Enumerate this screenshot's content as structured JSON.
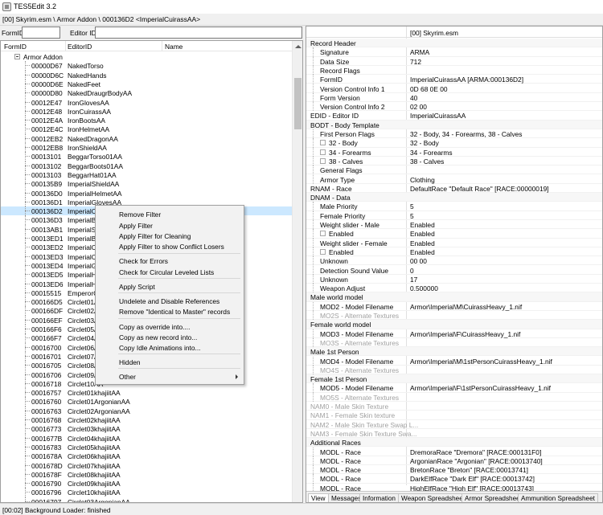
{
  "window": {
    "title": "TES5Edit 3.2",
    "icon": "app-icon"
  },
  "path": "[00] Skyrim.esm \\ Armor Addon \\ 000136D2 <ImperialCuirassAA>",
  "filter": {
    "formid_label": "FormID",
    "editorid_label": "Editor ID",
    "formid_value": "",
    "editorid_value": ""
  },
  "tree": {
    "columns": [
      "FormID",
      "EditorID",
      "Name"
    ],
    "root": "Armor Addon",
    "rows": [
      {
        "formid": "00000D67",
        "editorid": "NakedTorso"
      },
      {
        "formid": "00000D6C",
        "editorid": "NakedHands"
      },
      {
        "formid": "00000D6E",
        "editorid": "NakedFeet"
      },
      {
        "formid": "00000D80",
        "editorid": "NakedDraugrBodyAA"
      },
      {
        "formid": "00012E47",
        "editorid": "IronGlovesAA"
      },
      {
        "formid": "00012E48",
        "editorid": "IronCuirassAA"
      },
      {
        "formid": "00012E4A",
        "editorid": "IronBootsAA"
      },
      {
        "formid": "00012E4C",
        "editorid": "IronHelmetAA"
      },
      {
        "formid": "00012EB2",
        "editorid": "NakedDragonAA"
      },
      {
        "formid": "00012EB8",
        "editorid": "IronShieldAA"
      },
      {
        "formid": "00013101",
        "editorid": "BeggarTorso01AA"
      },
      {
        "formid": "00013102",
        "editorid": "BeggarBoots01AA"
      },
      {
        "formid": "00013103",
        "editorid": "BeggarHat01AA"
      },
      {
        "formid": "000135B9",
        "editorid": "ImperialShieldAA"
      },
      {
        "formid": "000136D0",
        "editorid": "ImperialHelmetAA"
      },
      {
        "formid": "000136D1",
        "editorid": "ImperialGlovesAA"
      },
      {
        "formid": "000136D2",
        "editorid": "ImperialCuirassAA"
      },
      {
        "formid": "000136D3",
        "editorid": "ImperialBoot"
      },
      {
        "formid": "00013AB1",
        "editorid": "ImperialShiel"
      },
      {
        "formid": "00013ED1",
        "editorid": "ImperialBoot"
      },
      {
        "formid": "00013ED2",
        "editorid": "ImperialCuir"
      },
      {
        "formid": "00013ED3",
        "editorid": "ImperialCuir"
      },
      {
        "formid": "00013ED4",
        "editorid": "ImperialGlov"
      },
      {
        "formid": "00013ED5",
        "editorid": "ImperialHelm"
      },
      {
        "formid": "00013ED6",
        "editorid": "ImperialHelm"
      },
      {
        "formid": "00015515",
        "editorid": "EmperorClot"
      },
      {
        "formid": "000166D5",
        "editorid": "Circlet01AA"
      },
      {
        "formid": "000166DF",
        "editorid": "Circlet02AA"
      },
      {
        "formid": "000166EF",
        "editorid": "Circlet03AA"
      },
      {
        "formid": "000166F6",
        "editorid": "Circlet05AA"
      },
      {
        "formid": "000166F7",
        "editorid": "Circlet04AA"
      },
      {
        "formid": "00016700",
        "editorid": "Circlet06AA"
      },
      {
        "formid": "00016701",
        "editorid": "Circlet07AA"
      },
      {
        "formid": "00016705",
        "editorid": "Circlet08AA"
      },
      {
        "formid": "00016706",
        "editorid": "Circlet09AA"
      },
      {
        "formid": "00016718",
        "editorid": "Circlet10AA"
      },
      {
        "formid": "00016757",
        "editorid": "Circlet01khajiitAA"
      },
      {
        "formid": "00016760",
        "editorid": "Circlet01ArgonianAA"
      },
      {
        "formid": "00016763",
        "editorid": "Circlet02ArgonianAA"
      },
      {
        "formid": "00016768",
        "editorid": "Circlet02khajiitAA"
      },
      {
        "formid": "00016773",
        "editorid": "Circlet03khajiitAA"
      },
      {
        "formid": "0001677B",
        "editorid": "Circlet04khajiitAA"
      },
      {
        "formid": "00016783",
        "editorid": "Circlet05khajiitAA"
      },
      {
        "formid": "0001678A",
        "editorid": "Circlet06khajiitAA"
      },
      {
        "formid": "0001678D",
        "editorid": "Circlet07khajiitAA"
      },
      {
        "formid": "0001678F",
        "editorid": "Circlet08khajiitAA"
      },
      {
        "formid": "00016790",
        "editorid": "Circlet09khajiitAA"
      },
      {
        "formid": "00016796",
        "editorid": "Circlet10khajiitAA"
      },
      {
        "formid": "00016797",
        "editorid": "Circlet03ArgonianAA"
      },
      {
        "formid": "0001679D",
        "editorid": "Circlet04ArgonianAA"
      }
    ],
    "selected_index": 16
  },
  "context_menu": {
    "items": [
      "Remove Filter",
      "Apply Filter",
      "Apply Filter for Cleaning",
      "Apply Filter to show Conflict Losers",
      "Check for Errors",
      "Check for Circular Leveled Lists",
      "Apply Script",
      "Undelete and Disable References",
      "Remove \"Identical to Master\" records",
      "Copy as override into....",
      "Copy as new record into...",
      "Copy Idle Animations into...",
      "Hidden",
      "Other"
    ]
  },
  "record": {
    "file_header": "[00] Skyrim.esm",
    "rows": [
      {
        "name": "Record Header",
        "value": "",
        "indent": 0,
        "kind": "section"
      },
      {
        "name": "Signature",
        "value": "ARMA",
        "indent": 1
      },
      {
        "name": "Data Size",
        "value": "712",
        "indent": 1
      },
      {
        "name": "Record Flags",
        "value": "",
        "indent": 1
      },
      {
        "name": "FormID",
        "value": "ImperialCuirassAA [ARMA:000136D2]",
        "indent": 1
      },
      {
        "name": "Version Control Info 1",
        "value": "0D 68 0E 00",
        "indent": 1
      },
      {
        "name": "Form Version",
        "value": "40",
        "indent": 1
      },
      {
        "name": "Version Control Info 2",
        "value": "02 00",
        "indent": 1
      },
      {
        "name": "EDID - Editor ID",
        "value": "ImperialCuirassAA",
        "indent": 0
      },
      {
        "name": "BODT - Body Template",
        "value": "",
        "indent": 0,
        "kind": "section"
      },
      {
        "name": "First Person Flags",
        "value": "32 - Body, 34 - Forearms, 38 - Calves",
        "indent": 1
      },
      {
        "name": "32 - Body",
        "value": "32 - Body",
        "indent": 2
      },
      {
        "name": "34 - Forearms",
        "value": "34 - Forearms",
        "indent": 2
      },
      {
        "name": "38 - Calves",
        "value": "38 - Calves",
        "indent": 2
      },
      {
        "name": "General Flags",
        "value": "",
        "indent": 1
      },
      {
        "name": "Armor Type",
        "value": "Clothing",
        "indent": 1
      },
      {
        "name": "RNAM - Race",
        "value": "DefaultRace \"Default Race\" [RACE:00000019]",
        "indent": 0
      },
      {
        "name": "DNAM - Data",
        "value": "",
        "indent": 0,
        "kind": "section"
      },
      {
        "name": "Male Priority",
        "value": "5",
        "indent": 1
      },
      {
        "name": "Female Priority",
        "value": "5",
        "indent": 1
      },
      {
        "name": "Weight slider - Male",
        "value": "Enabled",
        "indent": 1
      },
      {
        "name": "Enabled",
        "value": "Enabled",
        "indent": 2
      },
      {
        "name": "Weight slider - Female",
        "value": "Enabled",
        "indent": 1
      },
      {
        "name": "Enabled",
        "value": "Enabled",
        "indent": 2
      },
      {
        "name": "Unknown",
        "value": "00 00",
        "indent": 1
      },
      {
        "name": "Detection Sound Value",
        "value": "0",
        "indent": 1
      },
      {
        "name": "Unknown",
        "value": "17",
        "indent": 1
      },
      {
        "name": "Weapon Adjust",
        "value": "0.500000",
        "indent": 1
      },
      {
        "name": "Male world model",
        "value": "",
        "indent": 0,
        "kind": "section"
      },
      {
        "name": "MOD2 - Model Filename",
        "value": "Armor\\Imperial\\M\\CuirassHeavy_1.nif",
        "indent": 1
      },
      {
        "name": "MO2S - Alternate Textures",
        "value": "",
        "indent": 1,
        "dim": true
      },
      {
        "name": "Female world model",
        "value": "",
        "indent": 0,
        "kind": "section"
      },
      {
        "name": "MOD3 - Model Filename",
        "value": "Armor\\Imperial\\F\\CuirassHeavy_1.nif",
        "indent": 1
      },
      {
        "name": "MO3S - Alternate Textures",
        "value": "",
        "indent": 1,
        "dim": true
      },
      {
        "name": "Male 1st Person",
        "value": "",
        "indent": 0,
        "kind": "section"
      },
      {
        "name": "MOD4 - Model Filename",
        "value": "Armor\\Imperial\\M\\1stPersonCuirassHeavy_1.nif",
        "indent": 1
      },
      {
        "name": "MO4S - Alternate Textures",
        "value": "",
        "indent": 1,
        "dim": true
      },
      {
        "name": "Female 1st Person",
        "value": "",
        "indent": 0,
        "kind": "section"
      },
      {
        "name": "MOD5 - Model Filename",
        "value": "Armor\\Imperial\\F\\1stPersonCuirassHeavy_1.nif",
        "indent": 1
      },
      {
        "name": "MO5S - Alternate Textures",
        "value": "",
        "indent": 1,
        "dim": true
      },
      {
        "name": "NAM0 - Male Skin Texture",
        "value": "",
        "indent": 0,
        "dim": true
      },
      {
        "name": "NAM1 - Female Skin texture",
        "value": "",
        "indent": 0,
        "dim": true
      },
      {
        "name": "NAM2 - Male Skin Texture Swap L...",
        "value": "",
        "indent": 0,
        "dim": true
      },
      {
        "name": "NAM3 - Female Skin Texture Swa...",
        "value": "",
        "indent": 0,
        "dim": true
      },
      {
        "name": "Additional Races",
        "value": "",
        "indent": 0,
        "kind": "section"
      },
      {
        "name": "MODL - Race",
        "value": "DremoraRace \"Dremora\" [RACE:000131F0]",
        "indent": 1
      },
      {
        "name": "MODL - Race",
        "value": "ArgonianRace \"Argonian\" [RACE:00013740]",
        "indent": 1
      },
      {
        "name": "MODL - Race",
        "value": "BretonRace \"Breton\" [RACE:00013741]",
        "indent": 1
      },
      {
        "name": "MODL - Race",
        "value": "DarkElfRace \"Dark Elf\" [RACE:00013742]",
        "indent": 1
      },
      {
        "name": "MODL - Race",
        "value": "HighElfRace \"High Elf\" [RACE:00013743]",
        "indent": 1
      }
    ]
  },
  "tabs": [
    "View",
    "Messages",
    "Information",
    "Weapon Spreadsheet",
    "Armor Spreadsheet",
    "Ammunition Spreadsheet"
  ],
  "active_tab": "View",
  "status": "[00:02] Background Loader: finished"
}
